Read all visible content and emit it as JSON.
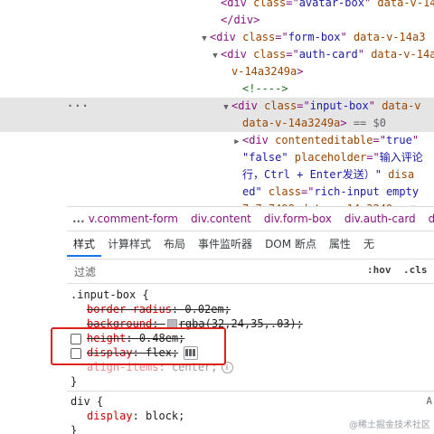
{
  "tree": {
    "lines": [
      {
        "indent": 2,
        "arrow": "",
        "html": [
          [
            "tag",
            "<div "
          ],
          [
            "an",
            "class"
          ],
          [
            "tag",
            "=\""
          ],
          [
            "av",
            "avatar-box"
          ],
          [
            "tag",
            "\" "
          ],
          [
            "an",
            "data-v-14a3"
          ]
        ]
      },
      {
        "indent": 2,
        "arrow": "",
        "html": [
          [
            "tag",
            "</div>"
          ]
        ]
      },
      {
        "indent": 1,
        "arrow": "▼",
        "html": [
          [
            "tag",
            "<div "
          ],
          [
            "an",
            "class"
          ],
          [
            "tag",
            "=\""
          ],
          [
            "av",
            "form-box"
          ],
          [
            "tag",
            "\" "
          ],
          [
            "an",
            "data-v-14a3"
          ]
        ]
      },
      {
        "indent": 2,
        "arrow": "▼",
        "html": [
          [
            "tag",
            "<div "
          ],
          [
            "an",
            "class"
          ],
          [
            "tag",
            "=\""
          ],
          [
            "av",
            "auth-card"
          ],
          [
            "tag",
            "\" "
          ],
          [
            "an",
            "data-v-14a"
          ]
        ]
      },
      {
        "indent": 3,
        "arrow": "",
        "html": [
          [
            "an",
            "v-14a3249a"
          ],
          [
            "tag",
            ">"
          ]
        ]
      },
      {
        "indent": 4,
        "arrow": "",
        "html": [
          [
            "cmt",
            "<!---->"
          ]
        ]
      },
      {
        "indent": 3,
        "arrow": "▼",
        "selected": true,
        "html": [
          [
            "tag",
            "<div "
          ],
          [
            "an",
            "class"
          ],
          [
            "tag",
            "=\""
          ],
          [
            "av",
            "input-box"
          ],
          [
            "tag",
            "\" "
          ],
          [
            "an",
            "data-v"
          ]
        ]
      },
      {
        "indent": 4,
        "arrow": "",
        "selected": true,
        "html": [
          [
            "an",
            "data-v-14a3249a"
          ],
          [
            "tag",
            ">"
          ],
          [
            "dim",
            " == $0"
          ]
        ]
      },
      {
        "indent": 4,
        "arrow": "▶",
        "html": [
          [
            "tag",
            "<div "
          ],
          [
            "an",
            "contenteditable"
          ],
          [
            "tag",
            "=\""
          ],
          [
            "av",
            "true"
          ],
          [
            "tag",
            "\""
          ]
        ]
      },
      {
        "indent": 4,
        "arrow": "",
        "html": [
          [
            "av",
            "\"false\" "
          ],
          [
            "an",
            "placeholder"
          ],
          [
            "tag",
            "=\""
          ],
          [
            "av",
            "输入评论"
          ]
        ]
      },
      {
        "indent": 4,
        "arrow": "",
        "html": [
          [
            "av",
            "行，Ctrl + Enter发送）\" "
          ],
          [
            "an",
            "disa"
          ]
        ]
      },
      {
        "indent": 4,
        "arrow": "",
        "html": [
          [
            "av",
            "ed\" "
          ],
          [
            "an",
            "class"
          ],
          [
            "tag",
            "=\""
          ],
          [
            "av",
            "rich-input empty"
          ]
        ]
      },
      {
        "indent": 4,
        "arrow": "",
        "html": [
          [
            "an",
            "7c7c7498 data-v-14a3249a"
          ],
          [
            "tag",
            ">"
          ]
        ]
      }
    ],
    "ellipsis": "…"
  },
  "breadcrumb": {
    "dots": "...",
    "items": [
      "v.comment-form",
      "div.content",
      "div.form-box",
      "div.auth-card",
      "d"
    ]
  },
  "tabs": {
    "items": [
      "样式",
      "计算样式",
      "布局",
      "事件监听器",
      "DOM 断点",
      "属性",
      "无"
    ],
    "active": 0
  },
  "filter": {
    "label": "过滤",
    "hov": ":hov",
    "cls": ".cls"
  },
  "rules": {
    "rule1": {
      "selector": ".input-box {",
      "decls": [
        {
          "name": "border-radius",
          "value": "0.02em",
          "disabled": true,
          "strike": true
        },
        {
          "name": "background",
          "value": "rgba(32,24,35,.03)",
          "disabled": true,
          "strike": true,
          "swatch": true
        },
        {
          "name": "height",
          "value": "0.48em",
          "strike": true,
          "checkbox": true
        },
        {
          "name": "display",
          "value": "flex",
          "strike": true,
          "checkbox": true,
          "flexbtn": true
        },
        {
          "name": "align-items",
          "value": "center",
          "faded": true,
          "info": true
        }
      ],
      "close": "}"
    },
    "rule2": {
      "selector": "div {",
      "source": "A",
      "decls": [
        {
          "name": "display",
          "value": "block"
        }
      ],
      "close": "}"
    }
  },
  "watermark": "@稀土掘金技术社区",
  "colors": {
    "highlight": "#e0201c",
    "active_tab": "#1a73e8",
    "selected_row": "#e5e5e5"
  }
}
